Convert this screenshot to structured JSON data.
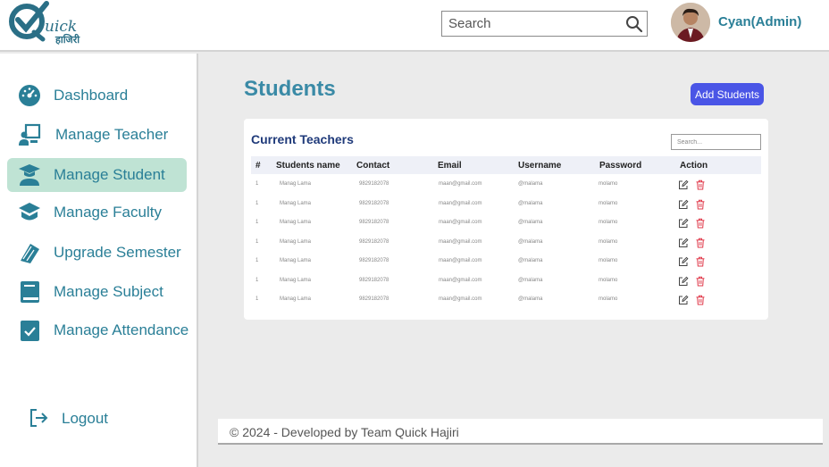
{
  "brand": {
    "logo_text": "uick",
    "logo_sub": "हाजिरी"
  },
  "search": {
    "placeholder": "Search"
  },
  "user": {
    "name": "Cyan(Admin)"
  },
  "sidebar": {
    "items": [
      {
        "label": "Dashboard",
        "icon": "speedometer-icon",
        "active": false
      },
      {
        "label": "Manage Teacher",
        "icon": "teacher-icon",
        "active": false
      },
      {
        "label": "Manage Student",
        "icon": "student-icon",
        "active": true
      },
      {
        "label": "Manage Faculty",
        "icon": "faculty-icon",
        "active": false
      },
      {
        "label": "Upgrade Semester",
        "icon": "books-icon",
        "active": false
      },
      {
        "label": "Manage Subject",
        "icon": "book-icon",
        "active": false
      },
      {
        "label": "Manage Attendance",
        "icon": "checklist-icon",
        "active": false
      }
    ],
    "logout": "Logout"
  },
  "main": {
    "title": "Students",
    "add_button": "Add Students",
    "table_title": "Current Teachers",
    "table_search_placeholder": "Search...",
    "columns": [
      "#",
      "Students name",
      "Contact",
      "Email",
      "Username",
      "Password",
      "Action"
    ],
    "rows": [
      [
        "1",
        "Manag Lama",
        "9829182078",
        "maan@gmail.com",
        "@malama",
        "molamo"
      ],
      [
        "1",
        "Manag Lama",
        "9829182078",
        "maan@gmail.com",
        "@malama",
        "molamo"
      ],
      [
        "1",
        "Manag Lama",
        "9829182078",
        "maan@gmail.com",
        "@malama",
        "molamo"
      ],
      [
        "1",
        "Manag Lama",
        "9829182078",
        "maan@gmail.com",
        "@malama",
        "molamo"
      ],
      [
        "1",
        "Manag Lama",
        "9829182078",
        "maan@gmail.com",
        "@malama",
        "molamo"
      ],
      [
        "1",
        "Manag Lama",
        "9829182078",
        "maan@gmail.com",
        "@malama",
        "molamo"
      ],
      [
        "1",
        "Manag Lama",
        "9829182078",
        "maan@gmail.com",
        "@malama",
        "molamo"
      ]
    ]
  },
  "footer": {
    "text": "© 2024 - Developed by Team Quick Hajiri"
  },
  "colors": {
    "accent": "#2a7f97",
    "button": "#4a55e6",
    "active_bg": "#bfe3d4",
    "delete": "#e0394a"
  }
}
